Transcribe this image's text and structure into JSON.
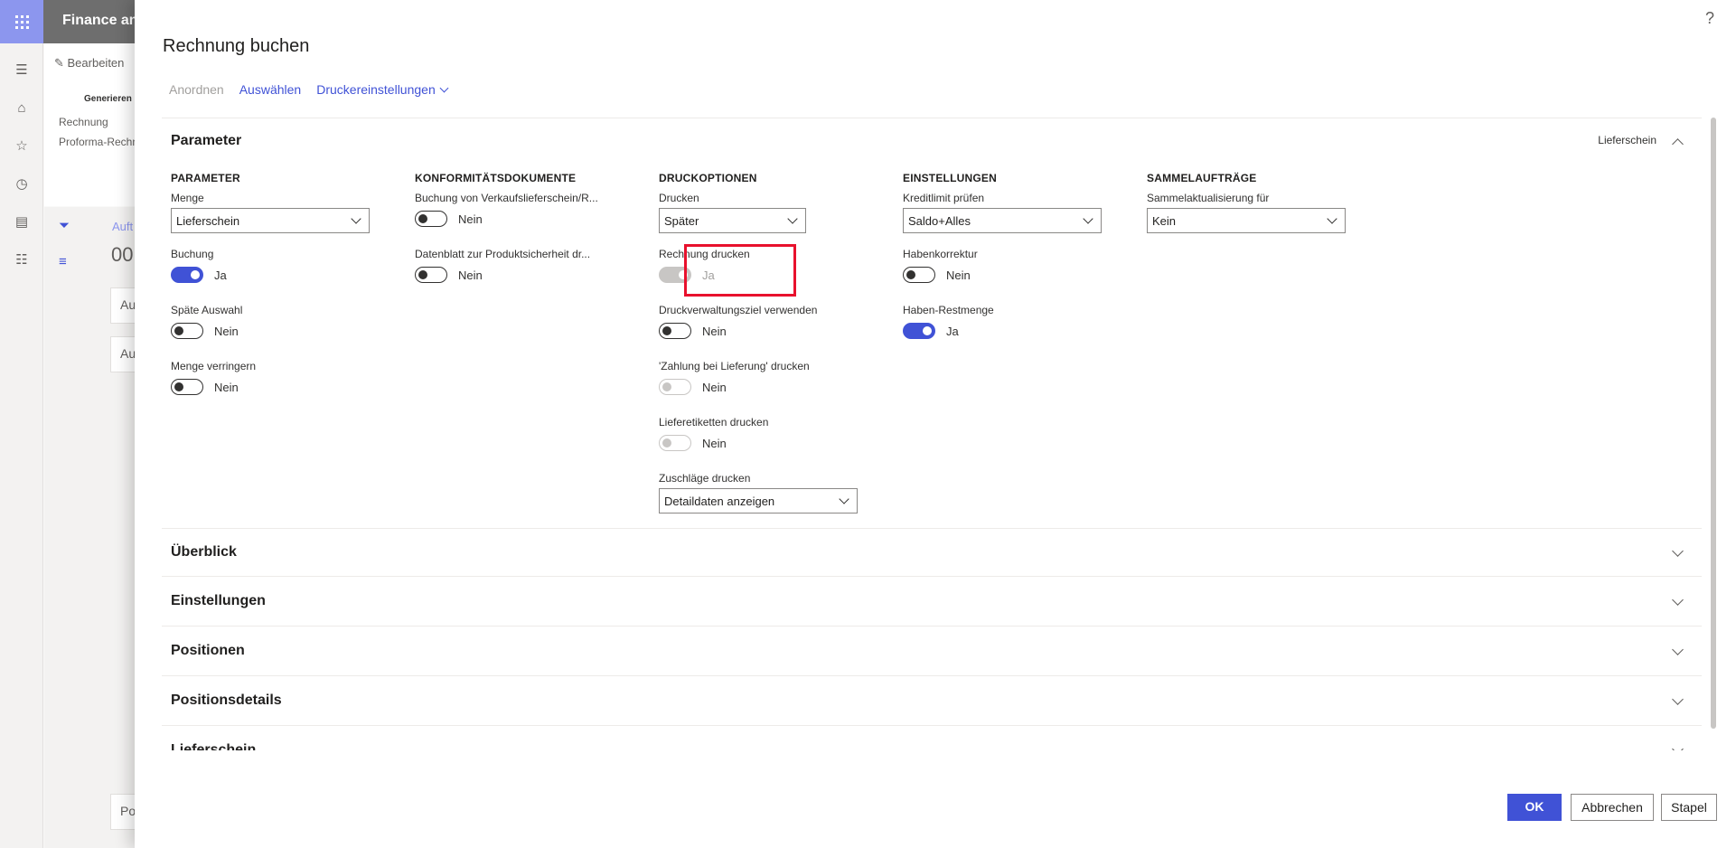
{
  "app": {
    "title": "Finance and Operations",
    "edit_label": "Bearbeiten",
    "generate_label": "Generieren",
    "links": [
      "Rechnung",
      "Proforma-Rechnung"
    ],
    "bg_record_prefix": "Auft",
    "bg_record_id": "00",
    "bg_fast_tabs": [
      "Au",
      "Au",
      "Po"
    ]
  },
  "dialog": {
    "title": "Rechnung buchen",
    "help": "?",
    "toolbar": {
      "arrange": "Anordnen",
      "select": "Auswählen",
      "printer_settings": "Druckereinstellungen"
    },
    "parameter_tab": {
      "title": "Parameter",
      "summary": "Lieferschein",
      "columns": {
        "parameter": {
          "heading": "PARAMETER",
          "quantity_label": "Menge",
          "quantity_value": "Lieferschein",
          "posting_label": "Buchung",
          "posting_value": "Ja",
          "late_selection_label": "Späte Auswahl",
          "late_selection_value": "Nein",
          "reduce_quantity_label": "Menge verringern",
          "reduce_quantity_value": "Nein"
        },
        "compliance": {
          "heading": "KONFORMITÄTSDOKUMENTE",
          "posting_sales_label": "Buchung von Verkaufslieferschein/R...",
          "posting_sales_value": "Nein",
          "datasheet_label": "Datenblatt zur Produktsicherheit dr...",
          "datasheet_value": "Nein"
        },
        "print_options": {
          "heading": "DRUCKOPTIONEN",
          "print_label": "Drucken",
          "print_value": "Später",
          "print_invoice_label": "Rechnung drucken",
          "print_invoice_value": "Ja",
          "print_mgmt_label": "Druckverwaltungsziel verwenden",
          "print_mgmt_value": "Nein",
          "cod_label": "'Zahlung bei Lieferung' drucken",
          "cod_value": "Nein",
          "shipping_labels_label": "Lieferetiketten drucken",
          "shipping_labels_value": "Nein",
          "charges_label": "Zuschläge drucken",
          "charges_value": "Detaildaten anzeigen"
        },
        "settings": {
          "heading": "EINSTELLUNGEN",
          "credit_limit_label": "Kreditlimit prüfen",
          "credit_limit_value": "Saldo+Alles",
          "credit_correction_label": "Habenkorrektur",
          "credit_correction_value": "Nein",
          "credit_remainder_label": "Haben-Restmenge",
          "credit_remainder_value": "Ja"
        },
        "summary_orders": {
          "heading": "SAMMELAUFTRÄGE",
          "summary_update_label": "Sammelaktualisierung für",
          "summary_update_value": "Kein"
        }
      }
    },
    "collapsed_tabs": [
      "Überblick",
      "Einstellungen",
      "Positionen",
      "Positionsdetails",
      "Lieferschein"
    ],
    "buttons": {
      "ok": "OK",
      "cancel": "Abbrechen",
      "batch": "Stapel"
    }
  },
  "colors": {
    "accent": "#4052d6",
    "highlight": "#e8112d",
    "waffle": "#8c96ee"
  }
}
